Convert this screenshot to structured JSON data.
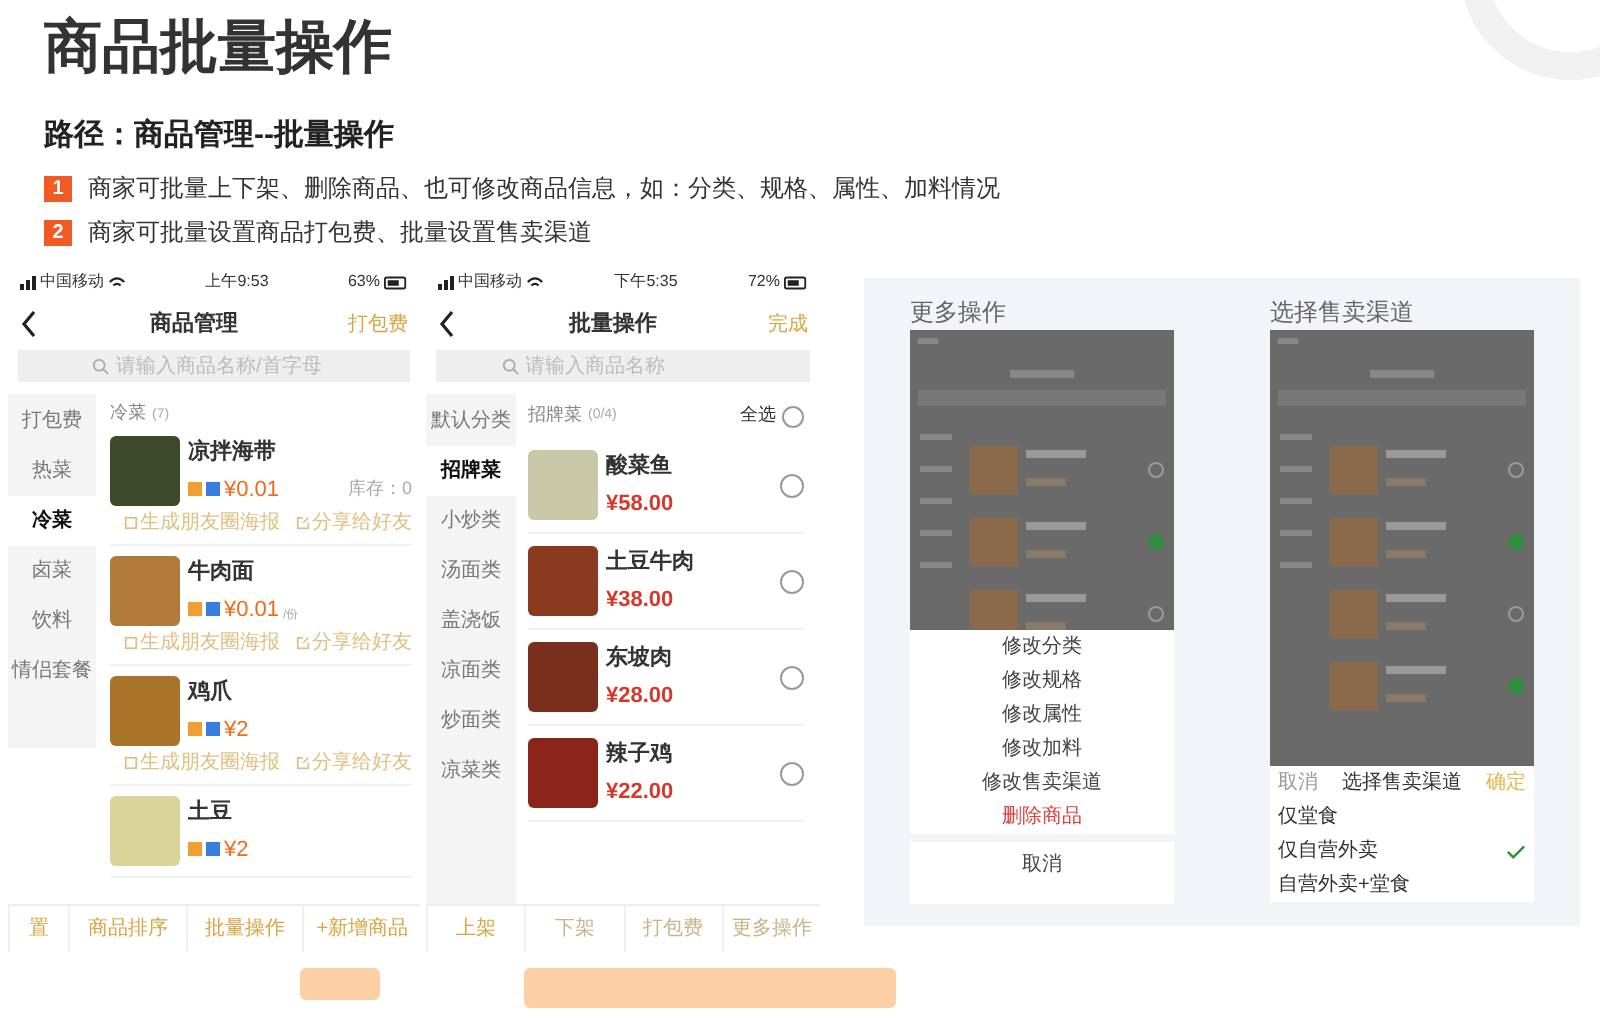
{
  "title": "商品批量操作",
  "path": "路径：商品管理--批量操作",
  "notes": [
    {
      "number": "1",
      "text": "商家可批量上下架、删除商品、也可修改商品信息，如：分类、规格、属性、加料情况"
    },
    {
      "number": "2",
      "text": "商家可批量设置商品打包费、批量设置售卖渠道"
    }
  ],
  "product_management": {
    "status_bar": {
      "carrier": "中国移动",
      "time": "上午9:53",
      "battery": "63%"
    },
    "nav": {
      "title": "商品管理",
      "action": "打包费"
    },
    "search": {
      "placeholder": "请输入商品名称/首字母"
    },
    "categories": [
      {
        "label": "打包费",
        "selected": false
      },
      {
        "label": "热菜",
        "selected": false
      },
      {
        "label": "冷菜",
        "selected": true
      },
      {
        "label": "卤菜",
        "selected": false
      },
      {
        "label": "饮料",
        "selected": false
      },
      {
        "label": "情侣套餐",
        "selected": false
      }
    ],
    "section": {
      "title": "冷菜",
      "count": "(7)"
    },
    "products": [
      {
        "name": "凉拌海带",
        "price": "¥0.01",
        "stock": "库存：0",
        "links": [
          "生成朋友圈海报",
          "分享给好友"
        ]
      },
      {
        "name": "牛肉面",
        "price": "¥0.01",
        "unit": "/份",
        "links": [
          "生成朋友圈海报",
          "分享给好友"
        ]
      },
      {
        "name": "鸡爪",
        "price": "¥2",
        "links": [
          "生成朋友圈海报",
          "分享给好友"
        ]
      },
      {
        "name": "土豆",
        "price": "¥2"
      }
    ],
    "bottom_bar": [
      "置",
      "商品排序",
      "批量操作",
      "+新增商品"
    ]
  },
  "batch_operation": {
    "status_bar": {
      "carrier": "中国移动",
      "time": "下午5:35",
      "battery": "72%"
    },
    "nav": {
      "title": "批量操作",
      "action": "完成"
    },
    "search": {
      "placeholder": "请输入商品名称"
    },
    "categories": [
      {
        "label": "默认分类",
        "selected": false
      },
      {
        "label": "招牌菜",
        "selected": true
      },
      {
        "label": "小炒类",
        "selected": false
      },
      {
        "label": "汤面类",
        "selected": false
      },
      {
        "label": "盖浇饭",
        "selected": false
      },
      {
        "label": "凉面类",
        "selected": false
      },
      {
        "label": "炒面类",
        "selected": false
      },
      {
        "label": "凉菜类",
        "selected": false
      }
    ],
    "section": {
      "title": "招牌菜",
      "count": "(0/4)",
      "select_all": "全选",
      "all_checked": false
    },
    "products": [
      {
        "name": "酸菜鱼",
        "price": "¥58.00",
        "checked": false
      },
      {
        "name": "土豆牛肉",
        "price": "¥38.00",
        "checked": false
      },
      {
        "name": "东坡肉",
        "price": "¥28.00",
        "checked": false
      },
      {
        "name": "辣子鸡",
        "price": "¥22.00",
        "checked": false
      }
    ],
    "bottom_bar": [
      {
        "label": "上架",
        "selected": true
      },
      {
        "label": "下架",
        "selected": false
      },
      {
        "label": "打包费",
        "selected": false
      },
      {
        "label": "更多操作",
        "selected": false
      }
    ]
  },
  "more_actions": {
    "heading": "更多操作",
    "dimmed_rows": [
      {
        "checked": false
      },
      {
        "checked": true
      },
      {
        "checked": false
      }
    ],
    "actions": [
      {
        "label": "修改分类",
        "kind": "normal"
      },
      {
        "label": "修改规格",
        "kind": "normal"
      },
      {
        "label": "修改属性",
        "kind": "normal"
      },
      {
        "label": "修改加料",
        "kind": "normal"
      },
      {
        "label": "修改售卖渠道",
        "kind": "normal"
      },
      {
        "label": "删除商品",
        "kind": "danger"
      }
    ],
    "cancel": "取消"
  },
  "sales_channel": {
    "heading": "选择售卖渠道",
    "dimmed_rows": [
      {
        "checked": false
      },
      {
        "checked": true
      },
      {
        "checked": false
      },
      {
        "checked": true
      }
    ],
    "sheet": {
      "cancel": "取消",
      "title": "选择售卖渠道",
      "confirm": "确定"
    },
    "options": [
      {
        "label": "仅堂食",
        "selected": false
      },
      {
        "label": "仅自营外卖",
        "selected": true
      },
      {
        "label": "自营外卖+堂食",
        "selected": false
      }
    ]
  }
}
